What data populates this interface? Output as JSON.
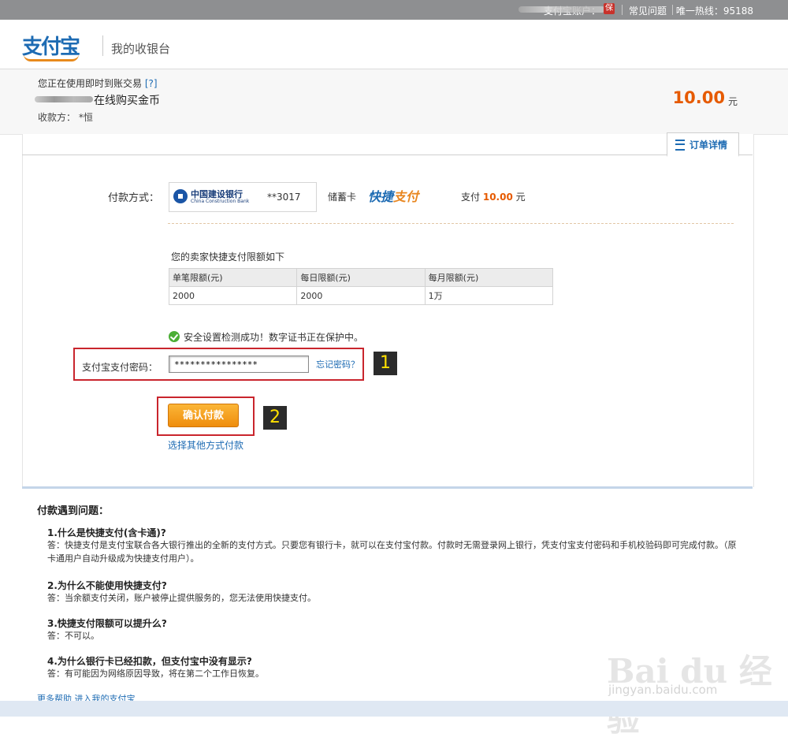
{
  "topbar": {
    "account_label": "支付宝账户：",
    "bao_badge": "保",
    "faq_link": "常见问题",
    "hotline": "唯一热线：95188"
  },
  "header": {
    "logo_text": "支付宝",
    "subtitle": "我的收银台"
  },
  "order": {
    "trade_type": "您正在使用即时到账交易",
    "help_link": "[?]",
    "product": "在线购买金币",
    "payee": "收款方：  *恒",
    "amount": "10.00",
    "currency": "元"
  },
  "detail_tab": "订单详情",
  "payment": {
    "method_label": "付款方式：",
    "bank_name": "中国建设银行",
    "bank_name_en": "China Construction Bank",
    "card_number": "**3017",
    "card_type": "储蓄卡",
    "kuaijie_a": "快捷",
    "kuaijie_b": "支付",
    "pay_prefix": "支付",
    "pay_amount": "10.00",
    "pay_suffix": "元"
  },
  "limits": {
    "title": "您的卖家快捷支付限额如下",
    "headers": [
      "单笔限额(元)",
      "每日限额(元)",
      "每月限额(元)"
    ],
    "values": [
      "2000",
      "2000",
      "1万"
    ]
  },
  "security_msg": "安全设置检测成功！数字证书正在保护中。",
  "password": {
    "label": "支付宝支付密码：",
    "value": "****************",
    "forgot": "忘记密码？"
  },
  "markers": [
    "1",
    "2"
  ],
  "confirm_button": "确认付款",
  "other_method": "选择其他方式付款",
  "faq": {
    "title": "付款遇到问题：",
    "items": [
      {
        "q": "1.什么是快捷支付(含卡通)?",
        "a": "答：快捷支付是支付宝联合各大银行推出的全新的支付方式。只要您有银行卡，就可以在支付宝付款。付款时无需登录网上银行，凭支付宝支付密码和手机校验码即可完成付款。（原卡通用户自动升级成为快捷支付用户）。"
      },
      {
        "q": "2.为什么不能使用快捷支付?",
        "a": "答：当余额支付关闭，账户被停止提供服务的，您无法使用快捷支付。"
      },
      {
        "q": "3.快捷支付限额可以提升么?",
        "a": "答：不可以。"
      },
      {
        "q": "4.为什么银行卡已经扣款，但支付宝中没有显示?",
        "a": "答：有可能因为网络原因导致，将在第二个工作日恢复。"
      }
    ]
  },
  "help_links": "更多帮助  进入我的支付宝",
  "watermark": "Bai du 经验",
  "watermark_url": "jingyan.baidu.com"
}
